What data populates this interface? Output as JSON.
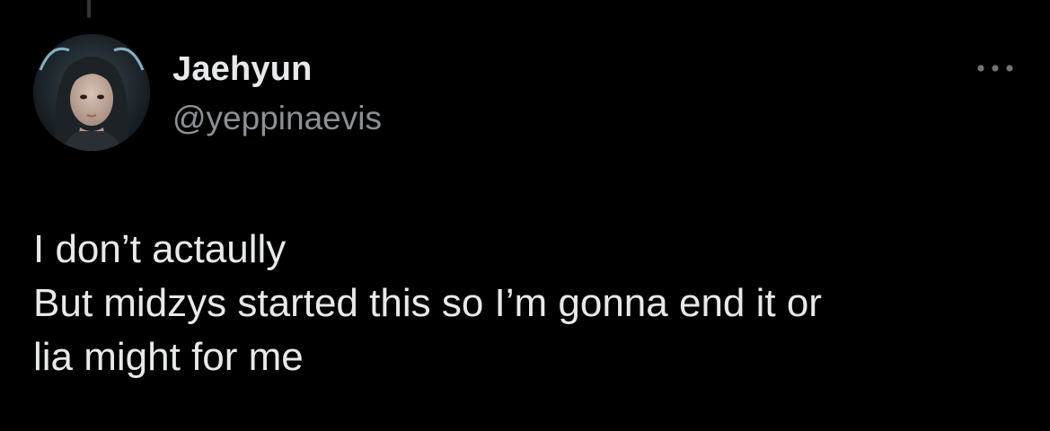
{
  "tweet": {
    "author": {
      "display_name": "Jaehyun",
      "handle": "@yeppinaevis"
    },
    "text_lines": [
      "I don’t actaully",
      "But midzys started this so I’m gonna end it or",
      "lia might for me"
    ]
  },
  "icons": {
    "more": "more-horizontal-icon",
    "avatar": "profile-photo"
  },
  "colors": {
    "background": "#000000",
    "primary_text": "#e7e9ea",
    "secondary_text": "#8b9196",
    "thread_line": "#333639"
  }
}
